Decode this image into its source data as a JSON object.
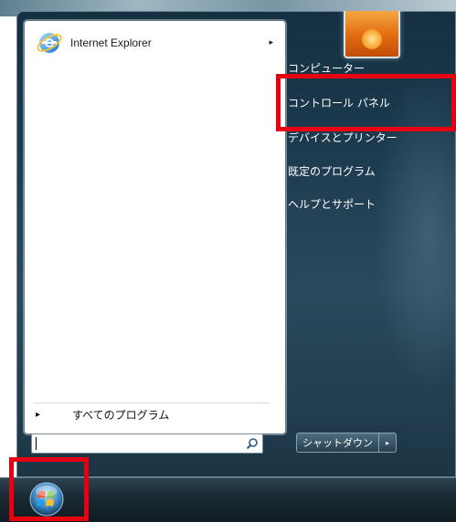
{
  "start_menu": {
    "pinned": {
      "label": "Internet Explorer",
      "icon": "internet-explorer-icon",
      "arrow": "▸"
    },
    "all_programs": {
      "arrow": "▸",
      "label": "すべてのプログラム"
    },
    "search": {
      "value": "",
      "icon": "search-icon"
    },
    "right_items": [
      "コンピューター",
      "コントロール パネル",
      "デバイスとプリンター",
      "既定のプログラム",
      "ヘルプとサポート"
    ],
    "shutdown": {
      "label": "シャットダウン",
      "arrow": "▸"
    }
  },
  "taskbar": {
    "start_icon": "windows-start-orb-icon"
  },
  "annotations": {
    "color": "#e60012"
  }
}
